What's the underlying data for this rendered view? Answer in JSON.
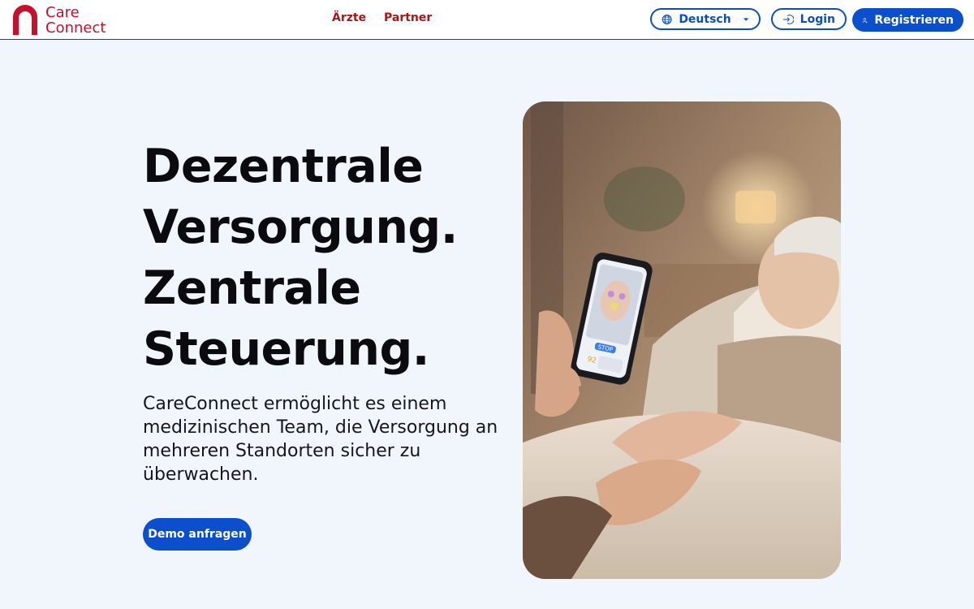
{
  "header": {
    "logo": {
      "line1": "Care",
      "line2": "Connect"
    },
    "nav": [
      {
        "label": "Ärzte"
      },
      {
        "label": "Partner"
      }
    ],
    "language": {
      "label": "Deutsch"
    },
    "login_label": "Login",
    "register_label": "Registrieren"
  },
  "hero": {
    "title_lines": [
      "Dezentrale",
      "Versorgung.",
      "Zentrale",
      "Steuerung."
    ],
    "subtitle": "CareConnect ermöglicht es einem medizinischen Team, die Versorgung an mehreren Standorten sicher zu überwachen.",
    "cta_label": "Demo anfragen",
    "image": {
      "phone_badge": "STOP",
      "phone_value": "92",
      "description_icon": "photo-elderly-patient-with-phone"
    }
  },
  "colors": {
    "brand_red": "#c8102e",
    "nav_red": "#a7171a",
    "primary_blue": "#0b4fcc",
    "background": "#f1f5fc"
  }
}
